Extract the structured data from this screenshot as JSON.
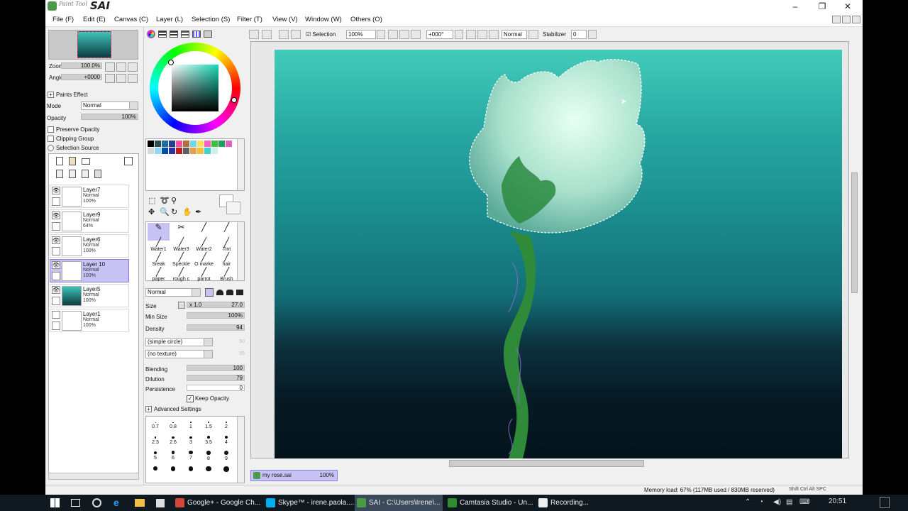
{
  "app": {
    "brand_small": "Paint Tool",
    "brand_big": "SAI"
  },
  "window_controls": {
    "minimize": "–",
    "maximize": "❐",
    "close": "✕"
  },
  "menu": [
    "File (F)",
    "Edit (E)",
    "Canvas (C)",
    "Layer (L)",
    "Selection (S)",
    "Filter (T)",
    "View (V)",
    "Window (W)",
    "Others (O)"
  ],
  "navigator": {
    "zoom_label": "Zoom",
    "zoom_value": "100.0%",
    "angle_label": "Angle",
    "angle_value": "+0000"
  },
  "paint_effect": {
    "title": "Paints Effect",
    "mode_label": "Mode",
    "mode_value": "Normal",
    "opacity_label": "Opacity",
    "opacity_value": "100%"
  },
  "options": [
    "Preserve Opacity",
    "Clipping Group",
    "Selection Source"
  ],
  "layers": [
    {
      "name": "Layer7",
      "mode": "Normal",
      "opacity": "100%",
      "selected": false,
      "eye": true
    },
    {
      "name": "Layer9",
      "mode": "Normal",
      "opacity": "64%",
      "selected": false,
      "eye": true
    },
    {
      "name": "Layer6",
      "mode": "Normal",
      "opacity": "100%",
      "selected": false,
      "eye": true
    },
    {
      "name": "Layer 10",
      "mode": "Normal",
      "opacity": "100%",
      "selected": true,
      "eye": true
    },
    {
      "name": "Layer5",
      "mode": "Normal",
      "opacity": "100%",
      "selected": false,
      "eye": true
    },
    {
      "name": "Layer1",
      "mode": "Normal",
      "opacity": "100%",
      "selected": false,
      "eye": false
    }
  ],
  "toolbar": {
    "selection_label": "Selection",
    "zoom": "100%",
    "angle": "+000°",
    "blend": "Normal",
    "stabilizer_label": "Stabilizer",
    "stabilizer_value": "0"
  },
  "swatch_colors": [
    "#000000",
    "#2f4f4f",
    "#1e6fa0",
    "#2a3c8c",
    "#ff4fa0",
    "#b07040",
    "#6fd8e8",
    "#f8e060",
    "#ff60c0",
    "#40c040",
    "#20a060",
    "#e060c0",
    "#d8d8d8",
    "#8fd8ff",
    "#0050a0",
    "#3030a0",
    "#c02020",
    "#606060",
    "#e8a050",
    "#f0c040",
    "#40d0d0",
    "#d0f0f0"
  ],
  "brushes": [
    {
      "name": "",
      "g": "✎"
    },
    {
      "name": "",
      "g": "✂"
    },
    {
      "name": "",
      "g": "╱"
    },
    {
      "name": "",
      "g": "╱"
    },
    {
      "name": "Water1",
      "g": "╱"
    },
    {
      "name": "Water3",
      "g": "╱"
    },
    {
      "name": "Water2",
      "g": "╱"
    },
    {
      "name": "Tint",
      "g": "╱"
    },
    {
      "name": "Sreak",
      "g": "╱"
    },
    {
      "name": "Speckle",
      "g": "╱"
    },
    {
      "name": "O marke",
      "g": "╱"
    },
    {
      "name": "hair",
      "g": "╱"
    },
    {
      "name": "paper",
      "g": "╱"
    },
    {
      "name": "rough c",
      "g": "╱"
    },
    {
      "name": "parrot",
      "g": "╱"
    },
    {
      "name": "Brush",
      "g": "╱"
    }
  ],
  "brush_settings": {
    "blend_mode": "Normal",
    "size_label": "Size",
    "size_mult": "x 1.0",
    "size_value": "27.0",
    "minsize_label": "Min Size",
    "minsize_value": "100%",
    "density_label": "Density",
    "density_value": "94",
    "shape": "(simple circle)",
    "shape_val": "50",
    "texture": "(no texture)",
    "texture_val": "95",
    "blending_label": "Blending",
    "blending_value": "100",
    "dilution_label": "Dilution",
    "dilution_value": "79",
    "persistence_label": "Persistence",
    "persistence_value": "0",
    "keep_opacity": "Keep Opacity",
    "advanced": "Advanced Settings"
  },
  "dot_sizes": [
    "0.7",
    "0.8",
    "1",
    "1.5",
    "2",
    "2.3",
    "2.6",
    "3",
    "3.5",
    "4",
    "5",
    "6",
    "7",
    "8",
    "9",
    "",
    "",
    "",
    "",
    ""
  ],
  "document": {
    "name": "my rose.sai",
    "zoom": "100%"
  },
  "status": {
    "memory": "Memory load: 67% (117MB used / 830MB reserved)",
    "keys": "Shift Ctrl Alt SPC"
  },
  "taskbar": {
    "items": [
      {
        "label": "Google+ - Google Ch...",
        "color": "#d44638"
      },
      {
        "label": "Skype™ - irene.paola....",
        "color": "#00aff0"
      },
      {
        "label": "SAI - C:\\Users\\Irene\\...",
        "color": "#4a9a4a"
      },
      {
        "label": "Camtasia Studio - Un...",
        "color": "#2e8b2e"
      },
      {
        "label": "Recording...",
        "color": "#eeeeee"
      }
    ],
    "time": "20:51"
  }
}
